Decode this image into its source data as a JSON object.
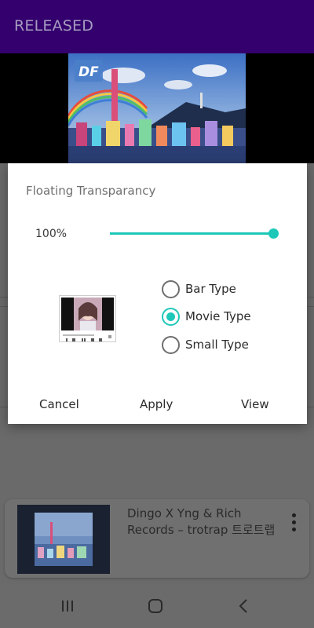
{
  "app_bar": {
    "title": "RELEASED",
    "background": "#34006e"
  },
  "dialog": {
    "title": "Floating Transparancy",
    "transparency_label": "100%",
    "transparency_value": 1.0,
    "accent": "#1ec8b9",
    "options": [
      {
        "label": "Bar Type",
        "checked": false
      },
      {
        "label": "Movie Type",
        "checked": true
      },
      {
        "label": "Small Type",
        "checked": false
      }
    ],
    "buttons": {
      "cancel": "Cancel",
      "apply": "Apply",
      "view": "View"
    }
  },
  "mini_player": {
    "title": "Dingo X Yng & Rich Records – trotrap 트로트랩",
    "more_icon": "more-vert-icon"
  },
  "nav_bar": {
    "recents_icon": "recent-apps-icon",
    "home_icon": "home-icon",
    "back_icon": "back-icon"
  }
}
